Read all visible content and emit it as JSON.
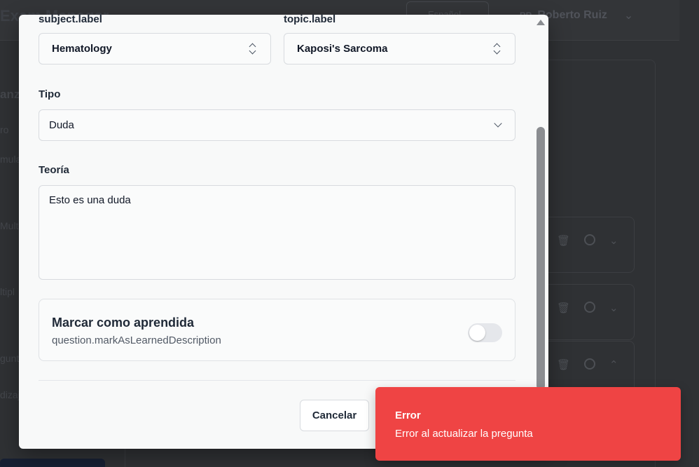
{
  "background": {
    "app_title": "Exam Manager",
    "language": "Español",
    "user": {
      "initials": "RR",
      "name": "Roberto Ruiz"
    },
    "sidebar_fragments": [
      "anz",
      "ro",
      "mula",
      "Multi",
      "ltipl",
      "gunt",
      "dizaj"
    ]
  },
  "form": {
    "subject": {
      "label": "subject.label",
      "value": "Hematology"
    },
    "topic": {
      "label": "topic.label",
      "value": "Kaposi's Sarcoma"
    },
    "type": {
      "label": "Tipo",
      "value": "Duda"
    },
    "theory": {
      "label": "Teoría",
      "value": "Esto es una duda"
    },
    "learned": {
      "title": "Marcar como aprendida",
      "description": "question.markAsLearnedDescription",
      "checked": false
    },
    "cancel_label": "Cancelar"
  },
  "toast": {
    "title": "Error",
    "message": "Error al actualizar la pregunta",
    "color": "#ef4444"
  }
}
